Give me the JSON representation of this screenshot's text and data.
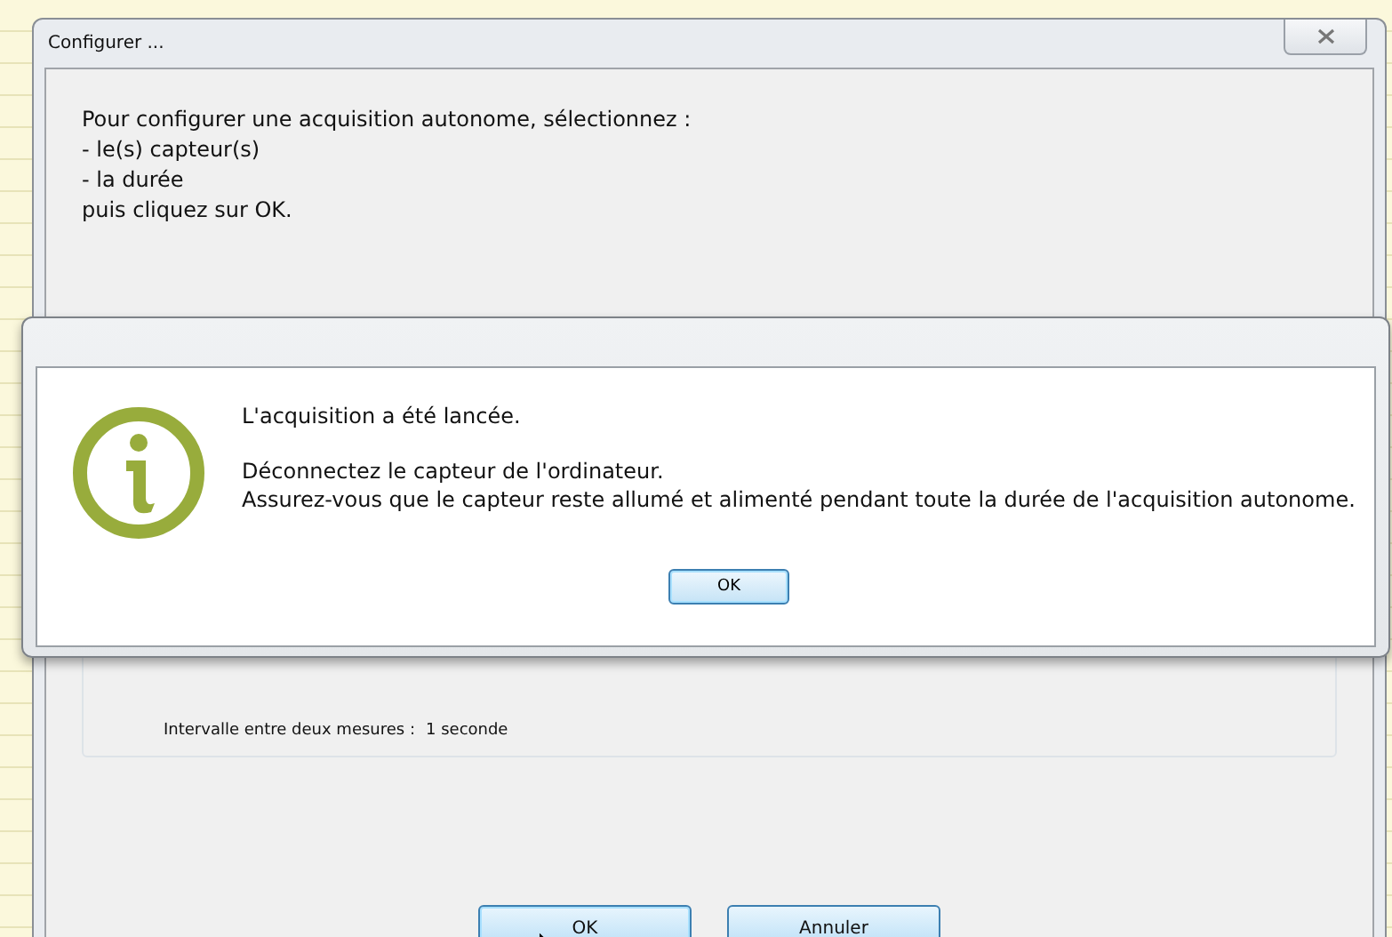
{
  "window": {
    "title": "Configurer ..."
  },
  "instructions": [
    "Pour configurer une acquisition autonome, sélectionnez :",
    "- le(s) capteur(s)",
    "- la durée",
    "puis cliquez sur OK."
  ],
  "interval": {
    "label": "Intervalle entre deux mesures :",
    "value": "1 seconde"
  },
  "buttons": [
    {
      "label": "OK",
      "kind": "default"
    },
    {
      "label": "Annuler",
      "kind": "normal"
    }
  ],
  "message_box": {
    "lines": [
      "L'acquisition a été lancée.",
      "Déconnectez le capteur de l'ordinateur.",
      "Assurez-vous que le capteur reste allumé et alimenté pendant toute la durée de l'acquisition autonome."
    ],
    "button": "OK"
  }
}
